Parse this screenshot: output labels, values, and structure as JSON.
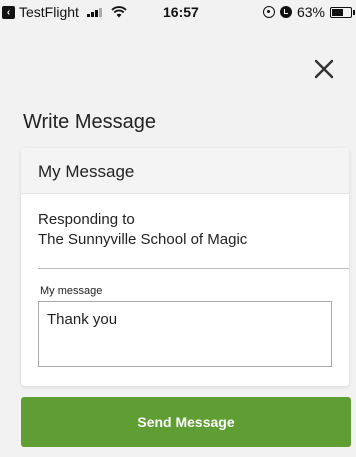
{
  "status_bar": {
    "app_name": "TestFlight",
    "time": "16:57",
    "battery": "63%",
    "battery_level": 0.63
  },
  "page": {
    "title": "Write Message",
    "close_icon": "close-icon"
  },
  "card": {
    "header": "My Message",
    "responding_label": "Responding to",
    "responding_to": "The Sunnyville School of Magic",
    "field_label": "My message",
    "message_value": "Thank you"
  },
  "actions": {
    "send_label": "Send Message"
  },
  "colors": {
    "accent": "#5f9e33",
    "background": "#f2f2f2"
  }
}
